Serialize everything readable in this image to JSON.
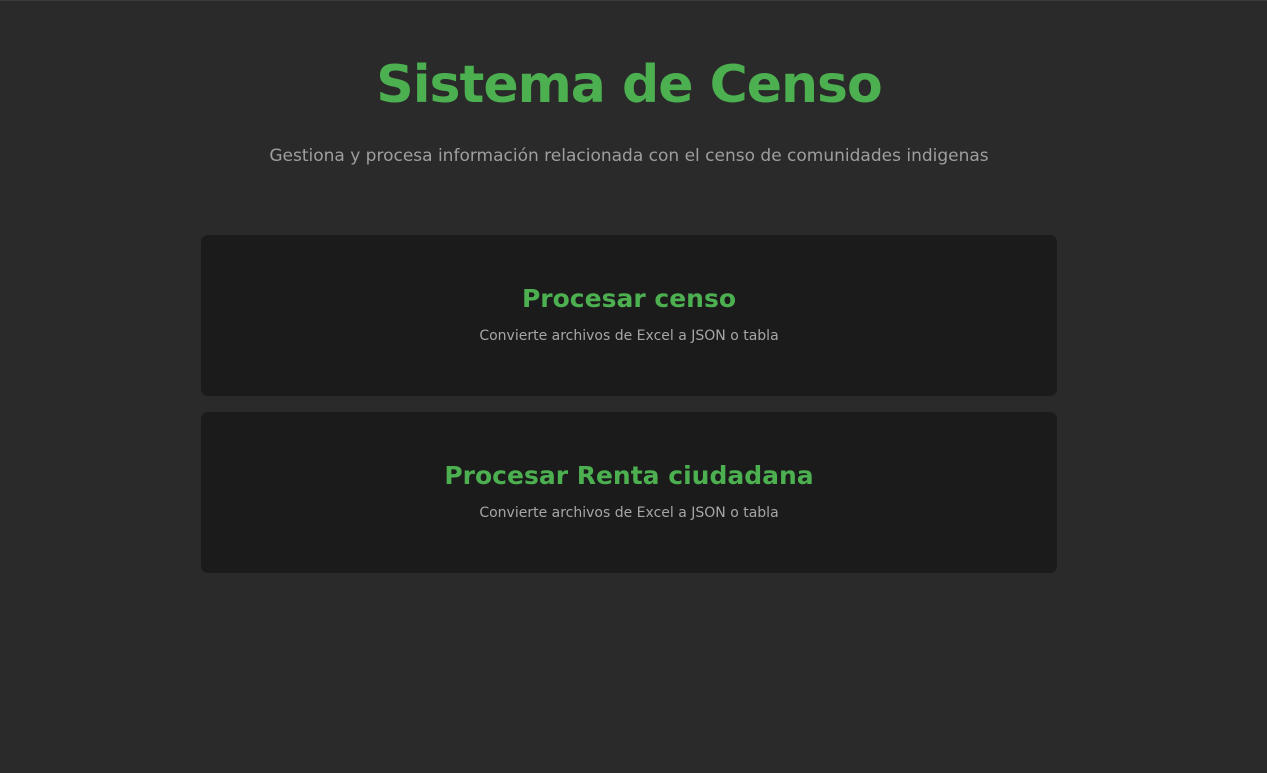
{
  "header": {
    "title": "Sistema de Censo",
    "subtitle": "Gestiona y procesa información relacionada con el censo de comunidades indigenas"
  },
  "cards": [
    {
      "title": "Procesar censo",
      "description": "Convierte archivos de Excel a JSON o tabla"
    },
    {
      "title": "Procesar Renta ciudadana",
      "description": "Convierte archivos de Excel a JSON o tabla"
    }
  ],
  "colors": {
    "accent": "#4caf50",
    "background": "#2a2a2a",
    "card_background": "#1b1b1b",
    "muted_text": "#9e9e9e"
  }
}
